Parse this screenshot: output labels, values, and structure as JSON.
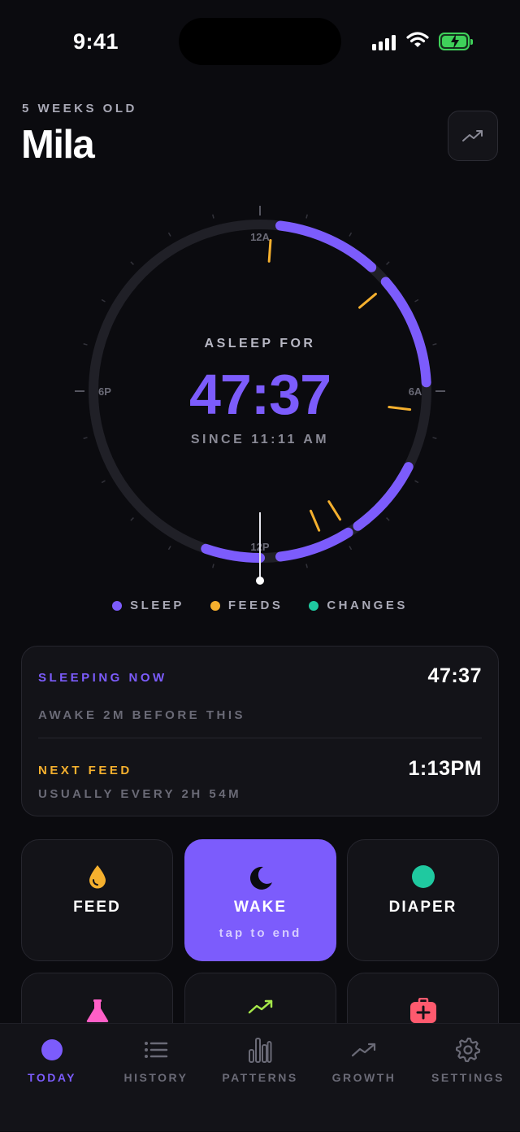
{
  "status_bar": {
    "time": "9:41"
  },
  "header": {
    "age": "5 WEEKS OLD",
    "name": "Mila"
  },
  "clock": {
    "label": "ASLEEP FOR",
    "value": "47:37",
    "since": "SINCE 11:11 AM",
    "hour_labels": {
      "top": "12A",
      "right": "6A",
      "bottom": "12P",
      "left": "6P"
    }
  },
  "legend": [
    {
      "label": "SLEEP",
      "color": "#7c5cfc"
    },
    {
      "label": "FEEDS",
      "color": "#f5b02e"
    },
    {
      "label": "CHANGES",
      "color": "#1fc9a0"
    }
  ],
  "status_card": {
    "sleeping_label": "SLEEPING NOW",
    "sleeping_value": "47:37",
    "sleeping_sub": "AWAKE 2M BEFORE THIS",
    "next_feed_label": "NEXT FEED",
    "next_feed_value": "1:13PM",
    "next_feed_sub": "USUALLY EVERY 2H 54M"
  },
  "actions": {
    "feed": {
      "label": "FEED",
      "icon": "drop-icon"
    },
    "wake": {
      "label": "WAKE",
      "sub": "tap to end",
      "icon": "moon-icon"
    },
    "diaper": {
      "label": "DIAPER",
      "icon": "circle-icon"
    }
  },
  "tabs": [
    {
      "label": "TODAY",
      "icon": "circle-icon",
      "active": true
    },
    {
      "label": "HISTORY",
      "icon": "list-icon"
    },
    {
      "label": "PATTERNS",
      "icon": "bars-icon"
    },
    {
      "label": "GROWTH",
      "icon": "trend-icon"
    },
    {
      "label": "SETTINGS",
      "icon": "gear-icon"
    }
  ],
  "colors": {
    "accent": "#7c5cfc",
    "feed": "#f5b02e",
    "change": "#1fc9a0",
    "background": "#0b0b0f"
  }
}
